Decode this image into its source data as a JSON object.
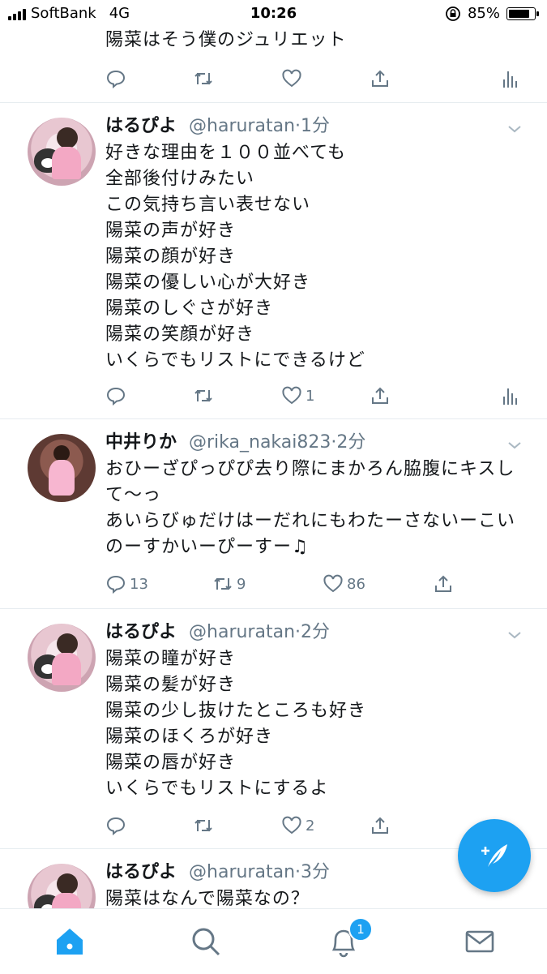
{
  "status_bar": {
    "carrier": "SoftBank",
    "network": "4G",
    "time": "10:26",
    "battery_percent": "85%",
    "battery_level": 0.85
  },
  "tweet0": {
    "text": "陽菜はそう僕のジュリエット"
  },
  "tweet1": {
    "name": "はるぴよ",
    "handle": "@haruratan",
    "time": "1分",
    "lines": [
      "好きな理由を１００並べても",
      "全部後付けみたい",
      "この気持ち言い表せない",
      "陽菜の声が好き",
      "陽菜の顔が好き",
      "陽菜の優しい心が大好き",
      "陽菜のしぐさが好き",
      "陽菜の笑顔が好き",
      "いくらでもリストにできるけど"
    ],
    "likes": "1"
  },
  "tweet2": {
    "name": "中井りか",
    "handle": "@rika_nakai823",
    "time": "2分",
    "lines": [
      "おひーざぴっぴぴ去り際にまかろん脇腹にキスし",
      "て〜っ",
      "あいらびゅだけはーだれにもわたーさないーこい",
      "のーすかいーぴーすー♫"
    ],
    "replies": "13",
    "retweets": "9",
    "likes": "86"
  },
  "tweet3": {
    "name": "はるぴよ",
    "handle": "@haruratan",
    "time": "2分",
    "lines": [
      "陽菜の瞳が好き",
      "陽菜の髪が好き",
      "陽菜の少し抜けたところも好き",
      "陽菜のほくろが好き",
      "陽菜の唇が好き",
      "いくらでもリストにするよ"
    ],
    "likes": "2"
  },
  "tweet4": {
    "name": "はるぴよ",
    "handle": "@haruratan",
    "time": "3分",
    "lines": [
      "陽菜はなんで陽菜なの？"
    ]
  },
  "tab_bar": {
    "notifications_badge": "1"
  },
  "colors": {
    "accent": "#1da1f2",
    "secondary_text": "#657786",
    "divider": "#e6ecf0"
  }
}
